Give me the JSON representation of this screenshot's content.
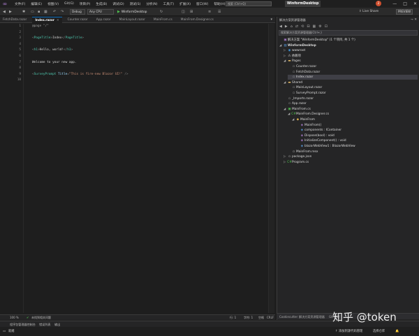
{
  "menubar": {
    "items": [
      "文件(F)",
      "编辑(E)",
      "视图(V)",
      "Git(G)",
      "项目(P)",
      "生成(B)",
      "调试(D)",
      "测试(S)",
      "分析(N)",
      "工具(T)",
      "扩展(X)",
      "窗口(W)",
      "帮助(H)"
    ],
    "search_placeholder": "搜索 (Ctrl+Q)",
    "window_title": "WinformDesktop",
    "notification_count": "2",
    "win_buttons": [
      "—",
      "□",
      "✕"
    ]
  },
  "toolbar": {
    "config": "Debug",
    "platform": "Any CPU",
    "run_label": "WinformDesktop",
    "live_share": "Live Share",
    "preview": "PREVIEW"
  },
  "editor": {
    "tabs": [
      {
        "label": "FetchData.razor",
        "active": false
      },
      {
        "label": "Index.razor",
        "active": true
      },
      {
        "label": "Counter.razor",
        "active": false
      },
      {
        "label": "App.razor",
        "active": false
      },
      {
        "label": "MainLayout.razor",
        "active": false
      },
      {
        "label": "MainFrom.cs",
        "active": false
      },
      {
        "label": "MainFrom.Designer.cs",
        "active": false
      }
    ],
    "lines": [
      {
        "n": "1",
        "segs": [
          [
            "c-dir",
            "@page \"/\""
          ]
        ]
      },
      {
        "n": "2",
        "segs": []
      },
      {
        "n": "3",
        "segs": [
          [
            "c-punc",
            "<"
          ],
          [
            "c-tag",
            "PageTitle"
          ],
          [
            "c-punc",
            ">"
          ],
          [
            "c-txt",
            "Index"
          ],
          [
            "c-punc",
            "</"
          ],
          [
            "c-tag",
            "PageTitle"
          ],
          [
            "c-punc",
            ">"
          ]
        ]
      },
      {
        "n": "4",
        "segs": []
      },
      {
        "n": "5",
        "segs": [
          [
            "c-punc",
            "<"
          ],
          [
            "c-tag",
            "h1"
          ],
          [
            "c-punc",
            ">"
          ],
          [
            "c-txt",
            "Hello, world!"
          ],
          [
            "c-punc",
            "</"
          ],
          [
            "c-tag",
            "h1"
          ],
          [
            "c-punc",
            ">"
          ]
        ]
      },
      {
        "n": "6",
        "segs": []
      },
      {
        "n": "7",
        "segs": [
          [
            "c-txt",
            "Welcome to your new app."
          ]
        ]
      },
      {
        "n": "8",
        "segs": []
      },
      {
        "n": "9",
        "segs": [
          [
            "c-punc",
            "<"
          ],
          [
            "c-tag",
            "SurveyPrompt"
          ],
          [
            "c-attr",
            " Title"
          ],
          [
            "c-punc",
            "="
          ],
          [
            "c-str",
            "\"This is fire-new Blazor UI!\""
          ],
          [
            "c-punc",
            " />"
          ]
        ]
      },
      {
        "n": "10",
        "segs": []
      }
    ],
    "status": {
      "zoom": "100 %",
      "issues": "未找到相关问题",
      "line": "行: 1",
      "char": "字符: 1",
      "space": "空格",
      "crlf": "CRLF"
    }
  },
  "solution_explorer": {
    "title": "解决方案资源管理器",
    "search_placeholder": "搜索解决方案资源管理器(Ctrl+;)",
    "tree": [
      {
        "label": "解决方案 \"WinformDesktop\" (1 个项目, 共 1 个)",
        "level": 0,
        "icon": "▣",
        "icls": "ic-sol",
        "arrow": "",
        "bold": false
      },
      {
        "label": "WinformDesktop",
        "level": 0,
        "icon": "▤",
        "icls": "ic-proj",
        "arrow": "◢",
        "bold": true
      },
      {
        "label": "wwwroot",
        "level": 1,
        "icon": "◉",
        "icls": "ic-globe",
        "arrow": "▷",
        "bold": false
      },
      {
        "label": "依赖项",
        "level": 1,
        "icon": "⁂",
        "icls": "ic-dep",
        "arrow": "▷",
        "bold": false
      },
      {
        "label": "Pages",
        "level": 1,
        "icon": "▬",
        "icls": "ic-folder",
        "arrow": "◢",
        "bold": false
      },
      {
        "label": "Counter.razor",
        "level": 2,
        "icon": "▫",
        "icls": "ic-razor",
        "arrow": "",
        "bold": false
      },
      {
        "label": "FetchData.razor",
        "level": 2,
        "icon": "▫",
        "icls": "ic-razor",
        "arrow": "",
        "bold": false
      },
      {
        "label": "Index.razor",
        "level": 2,
        "icon": "▫",
        "icls": "ic-razor",
        "arrow": "",
        "bold": false,
        "selected": true
      },
      {
        "label": "Shared",
        "level": 1,
        "icon": "▬",
        "icls": "ic-folder",
        "arrow": "◢",
        "bold": false
      },
      {
        "label": "MainLayout.razor",
        "level": 2,
        "icon": "▫",
        "icls": "ic-razor",
        "arrow": "",
        "bold": false
      },
      {
        "label": "SurveyPrompt.razor",
        "level": 2,
        "icon": "▫",
        "icls": "ic-razor",
        "arrow": "",
        "bold": false
      },
      {
        "label": "_Imports.razor",
        "level": 1,
        "icon": "▫",
        "icls": "ic-razor",
        "arrow": "",
        "bold": false
      },
      {
        "label": "App.razor",
        "level": 1,
        "icon": "▫",
        "icls": "ic-razor",
        "arrow": "",
        "bold": false
      },
      {
        "label": "MainFrom.cs",
        "level": 1,
        "icon": "▣",
        "icls": "ic-cs",
        "arrow": "◢",
        "bold": false
      },
      {
        "label": "MainFrom.Designer.cs",
        "level": 2,
        "icon": "C#",
        "icls": "ic-cs",
        "arrow": "◢",
        "bold": false
      },
      {
        "label": "MainFrom",
        "level": 3,
        "icon": "◆",
        "icls": "ic-class",
        "arrow": "◢",
        "bold": false
      },
      {
        "label": "MainFrom()",
        "level": 4,
        "icon": "◈",
        "icls": "ic-method",
        "arrow": "",
        "bold": false
      },
      {
        "label": "components : IContainer",
        "level": 4,
        "icon": "◈",
        "icls": "ic-field",
        "arrow": "",
        "bold": false
      },
      {
        "label": "Dispose(bool) : void",
        "level": 4,
        "icon": "◈",
        "icls": "ic-method",
        "arrow": "",
        "bold": false
      },
      {
        "label": "InitializeComponent() : void",
        "level": 4,
        "icon": "◈",
        "icls": "ic-method",
        "arrow": "",
        "bold": false
      },
      {
        "label": "blazorWebView1 : BlazorWebView",
        "level": 4,
        "icon": "◈",
        "icls": "ic-field",
        "arrow": "",
        "bold": false
      },
      {
        "label": "MainFrom.resx",
        "level": 2,
        "icon": "▫",
        "icls": "ic-file",
        "arrow": "",
        "bold": false
      },
      {
        "label": "package.json",
        "level": 1,
        "icon": "▫",
        "icls": "ic-file",
        "arrow": "▷",
        "bold": false
      },
      {
        "label": "Program.cs",
        "level": 1,
        "icon": "C#",
        "icls": "ic-cs",
        "arrow": "▷",
        "bold": false
      }
    ],
    "bottom_tabs": [
      "Cookiecutter",
      "解决方案资源管理器",
      "Git 更改"
    ]
  },
  "bottom_panel": {
    "tabs": [
      "程序包管理器控制台",
      "错误列表",
      "输出"
    ]
  },
  "statusbar": {
    "ready": "就绪",
    "add_source_control": "↑ 添加到源代码管理",
    "select_repo": "选择仓库"
  },
  "watermark": "知乎 @token"
}
